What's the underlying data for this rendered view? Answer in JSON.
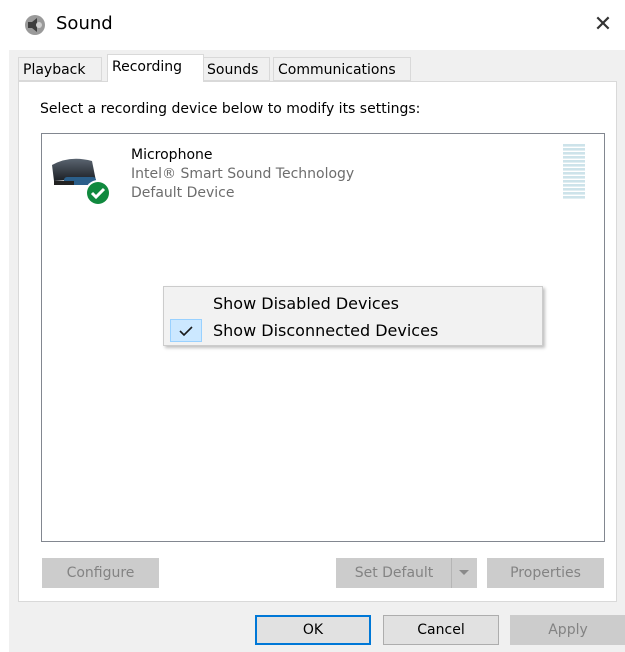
{
  "window": {
    "title": "Sound",
    "close_glyph": "✕"
  },
  "tabs": [
    {
      "label": "Playback"
    },
    {
      "label": "Recording",
      "active": true
    },
    {
      "label": "Sounds"
    },
    {
      "label": "Communications"
    }
  ],
  "instruction": "Select a recording device below to modify its settings:",
  "device": {
    "name": "Microphone",
    "driver": "Intel® Smart Sound Technology",
    "status": "Default Device",
    "icon": "microphone-icon",
    "badge_icon": "default-check-icon",
    "level_percent": 0
  },
  "context_menu": {
    "items": [
      {
        "label": "Show Disabled Devices",
        "checked": false
      },
      {
        "label": "Show Disconnected Devices",
        "checked": true
      }
    ],
    "check_glyph": "✓"
  },
  "buttons": {
    "configure": "Configure",
    "set_default": "Set Default",
    "properties": "Properties",
    "ok": "OK",
    "cancel": "Cancel",
    "apply": "Apply"
  },
  "colors": {
    "accent": "#0078d7",
    "check_green": "#10893e",
    "menu_highlight": "#cce8ff"
  }
}
